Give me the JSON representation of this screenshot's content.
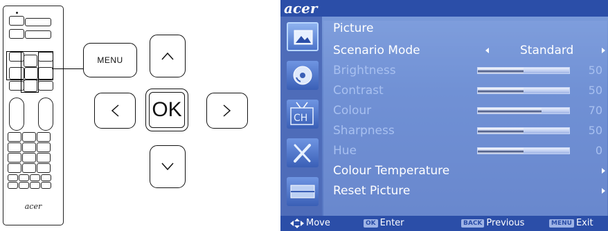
{
  "remote": {
    "logo": "acer"
  },
  "nav": {
    "menu_label": "MENU",
    "ok_label": "OK"
  },
  "osd": {
    "logo": "acer",
    "section_title": "Picture",
    "tabs": [
      "picture-icon",
      "disc-icon",
      "ch-icon",
      "tools-icon",
      "monitor-icon"
    ],
    "tab_ch_label": "CH",
    "scenario": {
      "label": "Scenario Mode",
      "value": "Standard"
    },
    "sliders": [
      {
        "label": "Brightness",
        "value": "50",
        "level": 50
      },
      {
        "label": "Contrast",
        "value": "50",
        "level": 50
      },
      {
        "label": "Colour",
        "value": "70",
        "level": 70
      },
      {
        "label": "Sharpness",
        "value": "50",
        "level": 50
      },
      {
        "label": "Hue",
        "value": "0",
        "level": 50
      }
    ],
    "colour_temp_label": "Colour Temperature",
    "reset_label": "Reset Picture",
    "footer": {
      "move": "Move",
      "ok_badge": "OK",
      "enter": "Enter",
      "back_badge": "BACK",
      "previous": "Previous",
      "menu_badge": "MENU",
      "exit": "Exit"
    },
    "colors": {
      "top_bar": "#2b4ea8",
      "background": "#6284cc",
      "dim_text": "#a8c0f0"
    }
  }
}
